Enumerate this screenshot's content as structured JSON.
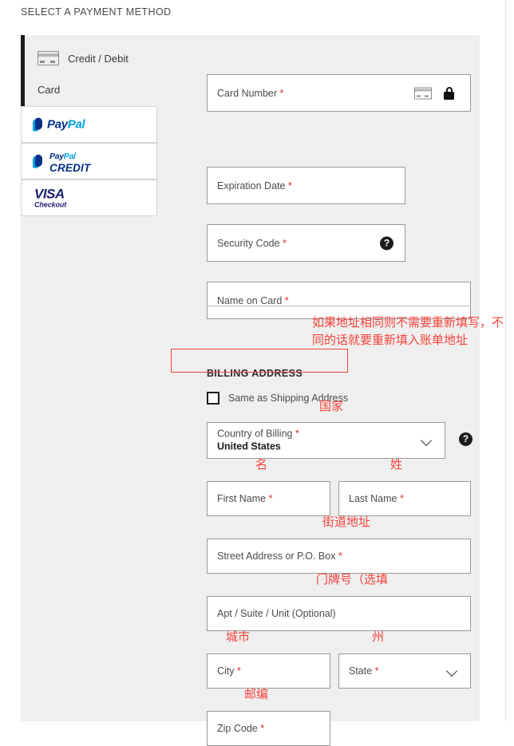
{
  "page": {
    "title": "SELECT A PAYMENT METHOD"
  },
  "payment_methods": {
    "selected": "credit-debit-card",
    "tabs": [
      {
        "id": "credit-debit-card",
        "icon": "credit-card-icon",
        "label_line1": "Credit / Debit",
        "label_line2": "Card",
        "selected": true
      },
      {
        "id": "paypal",
        "icon": "paypal-logo",
        "logo_pay": "Pay",
        "logo_pal": "Pal"
      },
      {
        "id": "paypal-credit",
        "icon": "paypal-credit-logo",
        "logo_pay": "Pay",
        "logo_pal": "Pal",
        "logo_credit": "CREDIT"
      },
      {
        "id": "visa-checkout",
        "icon": "visa-checkout-logo",
        "logo_visa": "VISA",
        "logo_checkout": "Checkout"
      }
    ]
  },
  "card_form": {
    "card_number": {
      "label": "Card Number",
      "required_mark": "*",
      "value": "",
      "icons": [
        "credit-card-icon",
        "lock-icon"
      ]
    },
    "expiration_date": {
      "label": "Expiration Date",
      "required_mark": "*",
      "value": ""
    },
    "security_code": {
      "label": "Security Code",
      "required_mark": "*",
      "value": "",
      "help": "?"
    },
    "name_on_card": {
      "label": "Name on Card",
      "required_mark": "*",
      "value": ""
    }
  },
  "billing": {
    "heading": "BILLING ADDRESS",
    "same_as_shipping": {
      "label": "Same as Shipping Address",
      "checked": false
    },
    "country": {
      "label": "Country of Billing",
      "required_mark": "*",
      "value": "United States",
      "help": "?"
    },
    "first_name": {
      "label": "First Name",
      "required_mark": "*",
      "value": ""
    },
    "last_name": {
      "label": "Last Name",
      "required_mark": "*",
      "value": ""
    },
    "street": {
      "label": "Street Address or P.O. Box",
      "required_mark": "*",
      "value": ""
    },
    "apt": {
      "label": "Apt / Suite / Unit (Optional)",
      "value": ""
    },
    "city": {
      "label": "City",
      "required_mark": "*",
      "value": ""
    },
    "state": {
      "label": "State",
      "required_mark": "*",
      "value": ""
    },
    "zip": {
      "label": "Zip Code",
      "required_mark": "*",
      "value": ""
    }
  },
  "annotations": {
    "color": "#f4433a",
    "note": "如果地址相同则不需要重新填写，不同的话就要重新填入账单地址",
    "country": "国家",
    "first_name": "名",
    "last_name": "姓",
    "street": "街道地址",
    "apt": "门牌号（选填",
    "city": "城市",
    "state": "州",
    "zip": "邮编"
  }
}
